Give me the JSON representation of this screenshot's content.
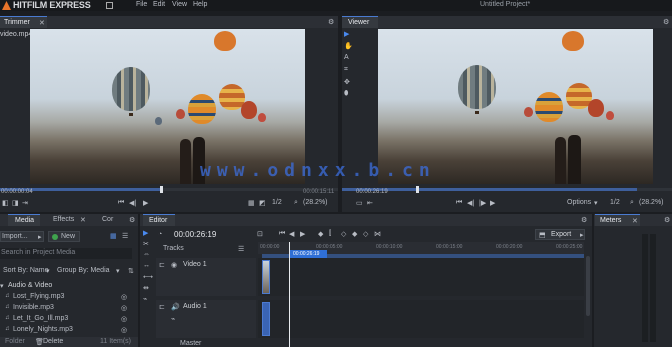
{
  "menu": {
    "logo": "HITFILM EXPRESS",
    "items": [
      "File",
      "Edit",
      "View",
      "Help"
    ],
    "project_title": "Untitled Project*"
  },
  "trimmer": {
    "tab": "Trimmer",
    "file": "video.mp4",
    "timecode_left": "00:00:00:04",
    "timecode_right": "00:00:15:11",
    "scale": "1/2",
    "zoom": "(28.2%)"
  },
  "viewer": {
    "tab": "Viewer",
    "timecode_left": "00:00:26:19",
    "options": "Options",
    "scale": "1/2",
    "zoom": "(28.2%)"
  },
  "watermark": "www.odnxx.b.cn",
  "media_panel": {
    "tabs": [
      "Media",
      "Effects",
      "Cor"
    ],
    "import": "Import...",
    "new": "New",
    "search_placeholder": "Search in Project Media",
    "sort_by": "Sort By: Name",
    "group_by": "Group By: Media",
    "folder": "Audio & Video",
    "files": [
      "Lost_Flying.mp3",
      "Invisible.mp3",
      "Let_It_Go_Ill.mp3",
      "Lonely_Nights.mp3"
    ],
    "footer_folder": "Folder",
    "footer_delete": "Delete",
    "footer_count": "11 Item(s)"
  },
  "editor": {
    "tab": "Editor",
    "timecode": "00:00:26:19",
    "export": "Export",
    "tracks_label": "Tracks",
    "video_track": "Video 1",
    "audio_track": "Audio 1",
    "master": "Master",
    "ruler": [
      "00:00:00",
      "00:00:05:00",
      "00:00:10:00",
      "00:00:15:00",
      "00:00:20:00",
      "00:00:25:00"
    ],
    "playhead_label": "00:00:26:19"
  },
  "meters": {
    "tab": "Meters"
  }
}
